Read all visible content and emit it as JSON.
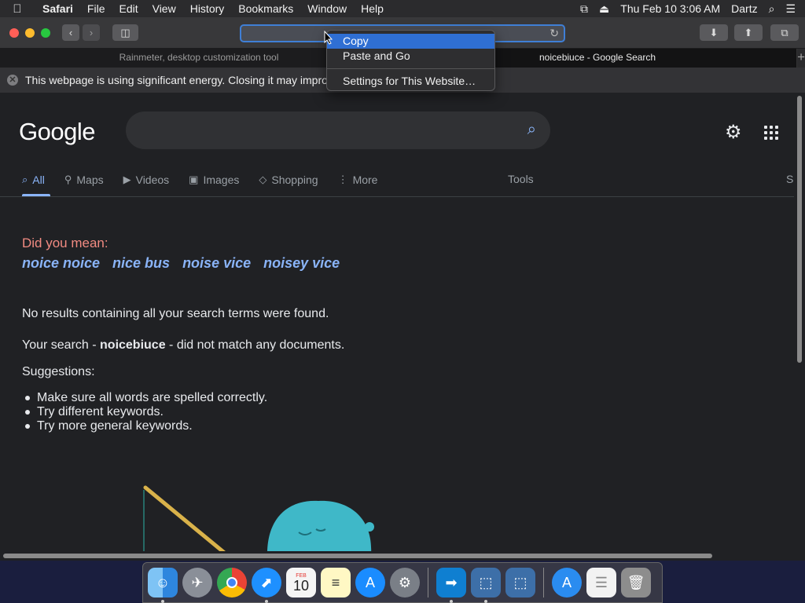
{
  "menubar": {
    "app": "Safari",
    "items": [
      "File",
      "Edit",
      "View",
      "History",
      "Bookmarks",
      "Window",
      "Help"
    ],
    "datetime": "Thu Feb 10  3:06 AM",
    "user": "Dartz"
  },
  "tabs": [
    {
      "title": "Rainmeter, desktop customization tool",
      "active": false
    },
    {
      "title": "noicebiuce - Google Search",
      "active": true
    }
  ],
  "tab_add": "+",
  "banner": {
    "text": "This webpage is using significant energy. Closing it may improv"
  },
  "context_menu": {
    "items": [
      "Copy",
      "Paste and Go"
    ],
    "extra": "Settings for This Website…",
    "highlighted": "Copy"
  },
  "google": {
    "logo": "Google",
    "nav": [
      "All",
      "Maps",
      "Videos",
      "Images",
      "Shopping",
      "More"
    ],
    "tools": "Tools",
    "s_edge": "S",
    "did_you_mean": "Did you mean:",
    "suggestions": [
      "noice noice",
      "nice bus",
      "noise vice",
      "noisey vice"
    ],
    "no_results": "No results containing all your search terms were found.",
    "your_search_prefix": "Your search - ",
    "query": "noicebiuce",
    "your_search_suffix": " - did not match any documents.",
    "suggestions_title": "Suggestions:",
    "tips": [
      "Make sure all words are spelled correctly.",
      "Try different keywords.",
      "Try more general keywords."
    ]
  },
  "dock": [
    "Finder",
    "Launchpad",
    "Chrome",
    "Safari",
    "Calendar",
    "Notes",
    "App Store",
    "System Preferences",
    "Migration",
    "VirtualBox",
    "VirtualBox VM",
    "App Store Folder",
    "Documents",
    "Trash"
  ],
  "calendar": {
    "month": "FEB",
    "day": "10"
  }
}
